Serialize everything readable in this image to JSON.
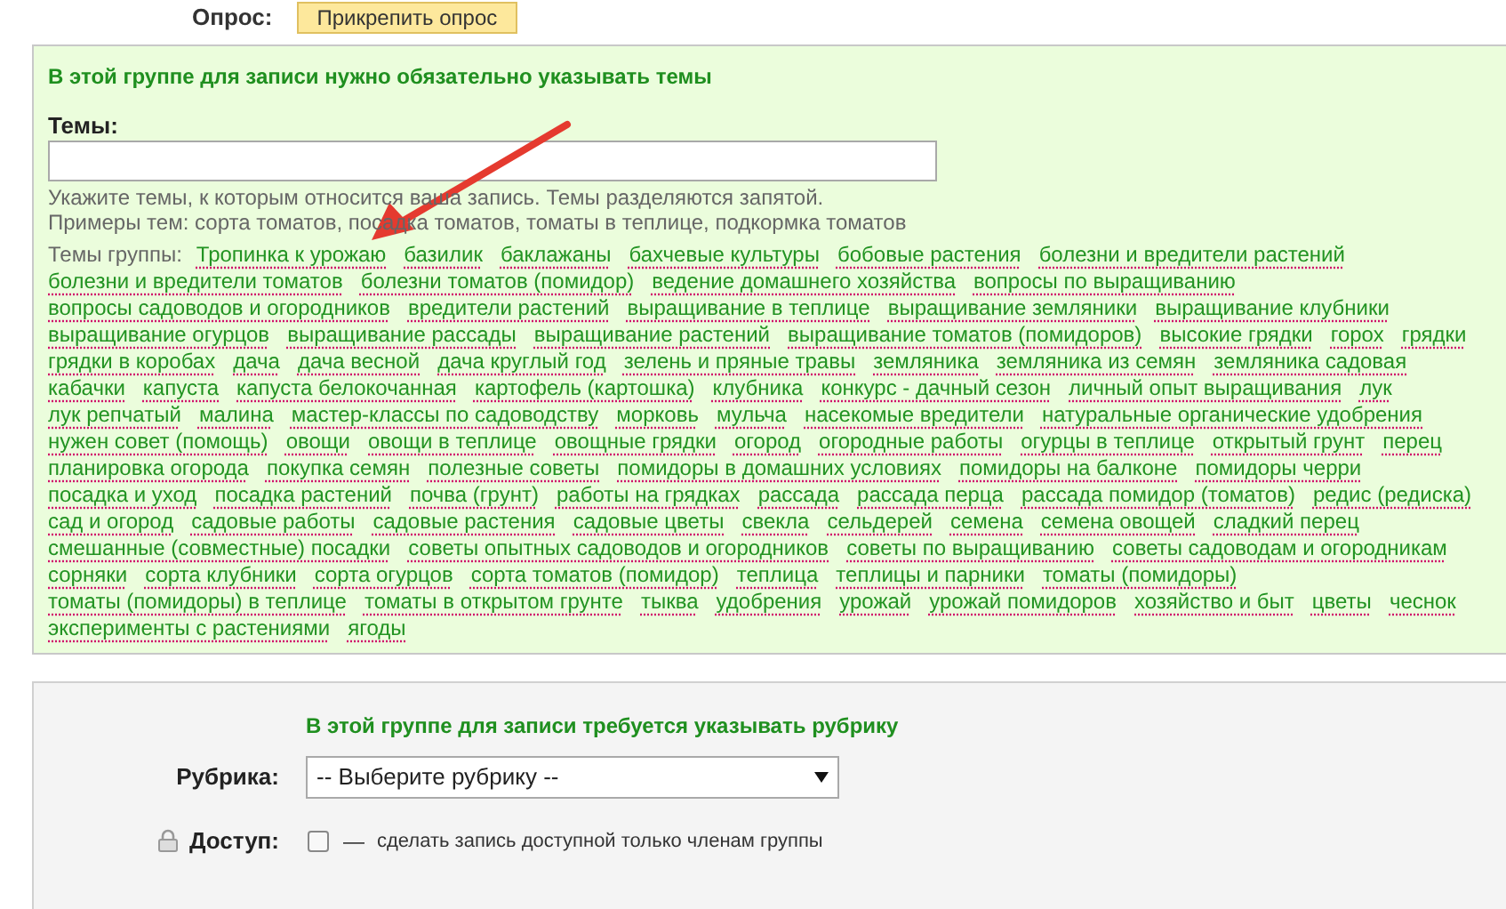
{
  "poll": {
    "label": "Опрос:",
    "button": "Прикрепить опрос"
  },
  "topics_panel": {
    "notice": "В этой группе для записи нужно обязательно указывать темы",
    "label": "Темы:",
    "hints": [
      "Укажите темы, к которым относится ваша запись. Темы разделяются запятой.",
      "Примеры тем: сорта томатов, посадка томатов, томаты в теплице, подкормка томатов"
    ],
    "group_topics_label": "Темы группы:",
    "topics": [
      "Тропинка к урожаю",
      "базилик",
      "баклажаны",
      "бахчевые культуры",
      "бобовые растения",
      "болезни и вредители растений",
      "болезни и вредители томатов",
      "болезни томатов (помидор)",
      "ведение домашнего хозяйства",
      "вопросы по выращиванию",
      "вопросы садоводов и огородников",
      "вредители растений",
      "выращивание в теплице",
      "выращивание земляники",
      "выращивание клубники",
      "выращивание огурцов",
      "выращивание рассады",
      "выращивание растений",
      "выращивание томатов (помидоров)",
      "высокие грядки",
      "горох",
      "грядки",
      "грядки в коробах",
      "дача",
      "дача весной",
      "дача круглый год",
      "зелень и пряные травы",
      "земляника",
      "земляника из семян",
      "земляника садовая",
      "кабачки",
      "капуста",
      "капуста белокочанная",
      "картофель (картошка)",
      "клубника",
      "конкурс - дачный сезон",
      "личный опыт выращивания",
      "лук",
      "лук репчатый",
      "малина",
      "мастер-классы по садоводству",
      "морковь",
      "мульча",
      "насекомые вредители",
      "натуральные органические удобрения",
      "нужен совет (помощь)",
      "овощи",
      "овощи в теплице",
      "овощные грядки",
      "огород",
      "огородные работы",
      "огурцы в теплице",
      "открытый грунт",
      "перец",
      "планировка огорода",
      "покупка семян",
      "полезные советы",
      "помидоры в домашних условиях",
      "помидоры на балконе",
      "помидоры черри",
      "посадка и уход",
      "посадка растений",
      "почва (грунт)",
      "работы на грядках",
      "рассада",
      "рассада перца",
      "рассада помидор (томатов)",
      "редис (редиска)",
      "сад и огород",
      "садовые работы",
      "садовые растения",
      "садовые цветы",
      "свекла",
      "сельдерей",
      "семена",
      "семена овощей",
      "сладкий перец",
      "смешанные (совместные) посадки",
      "советы опытных садоводов и огородников",
      "советы по выращиванию",
      "советы садоводам и огородникам",
      "сорняки",
      "сорта клубники",
      "сорта огурцов",
      "сорта томатов (помидор)",
      "теплица",
      "теплицы и парники",
      "томаты (помидоры)",
      "томаты (помидоры) в теплице",
      "томаты в открытом грунте",
      "тыква",
      "удобрения",
      "урожай",
      "урожай помидоров",
      "хозяйство и быт",
      "цветы",
      "чеснок",
      "эксперименты с растениями",
      "ягоды"
    ]
  },
  "rubric_panel": {
    "notice": "В этой группе для записи требуется указывать рубрику",
    "rubric": {
      "label": "Рубрика:",
      "value": "-- Выберите рубрику --"
    },
    "access": {
      "label": "Доступ:",
      "checked": false,
      "dash": "—",
      "text": "сделать запись доступной только членам группы"
    }
  }
}
